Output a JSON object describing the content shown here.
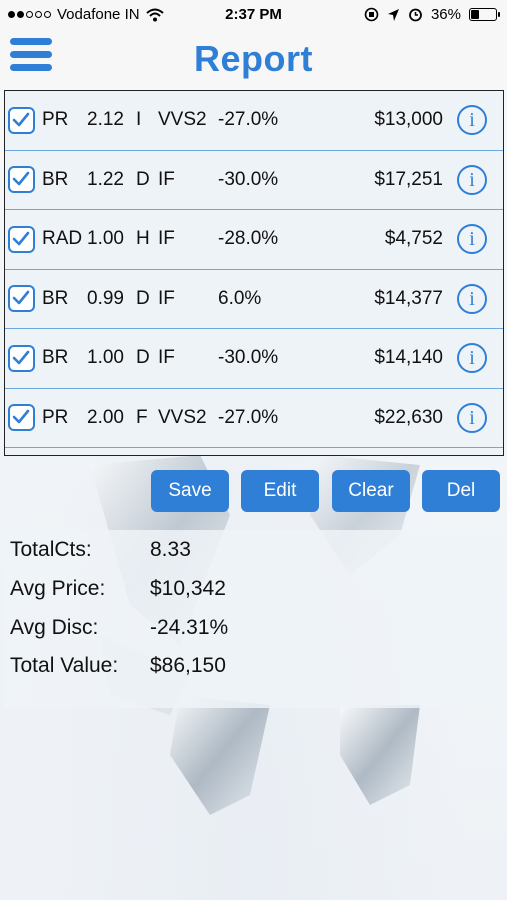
{
  "status_bar": {
    "carrier": "Vodafone IN",
    "time": "2:37 PM",
    "battery_percent": "36%",
    "battery_level": 0.36,
    "signal_dots_filled": 2,
    "signal_dots_total": 5
  },
  "navbar": {
    "title": "Report",
    "menu_icon": "hamburger-menu-icon"
  },
  "colors": {
    "accent": "#2f7fd6",
    "row_divider": "#6ea7dd",
    "list_bg": "#eef3f8"
  },
  "report_rows": [
    {
      "checked": true,
      "shape": "PR",
      "size": "2.12",
      "color": "I",
      "clarity": "VVS2",
      "discount": "-27.0%",
      "price": "$13,000"
    },
    {
      "checked": true,
      "shape": "BR",
      "size": "1.22",
      "color": "D",
      "clarity": "IF",
      "discount": "-30.0%",
      "price": "$17,251"
    },
    {
      "checked": true,
      "shape": "RAD",
      "size": "1.00",
      "color": "H",
      "clarity": "IF",
      "discount": "-28.0%",
      "price": "$4,752"
    },
    {
      "checked": true,
      "shape": "BR",
      "size": "0.99",
      "color": "D",
      "clarity": "IF",
      "discount": "6.0%",
      "price": "$14,377"
    },
    {
      "checked": true,
      "shape": "BR",
      "size": "1.00",
      "color": "D",
      "clarity": "IF",
      "discount": "-30.0%",
      "price": "$14,140"
    },
    {
      "checked": true,
      "shape": "PR",
      "size": "2.00",
      "color": "F",
      "clarity": "VVS2",
      "discount": "-27.0%",
      "price": "$22,630"
    }
  ],
  "buttons": {
    "save": "Save",
    "edit": "Edit",
    "clear": "Clear",
    "del": "Del"
  },
  "summary": {
    "total_cts_label": "TotalCts:",
    "total_cts": "8.33",
    "avg_price_label": "Avg Price:",
    "avg_price": "$10,342",
    "avg_disc_label": "Avg Disc:",
    "avg_disc": "-24.31%",
    "total_value_label": "Total Value:",
    "total_value": "$86,150"
  },
  "icons": {
    "checkbox": "checkbox-checked-icon",
    "info": "info-icon",
    "wifi": "wifi-icon",
    "battery": "battery-icon"
  },
  "info_glyph": "i"
}
